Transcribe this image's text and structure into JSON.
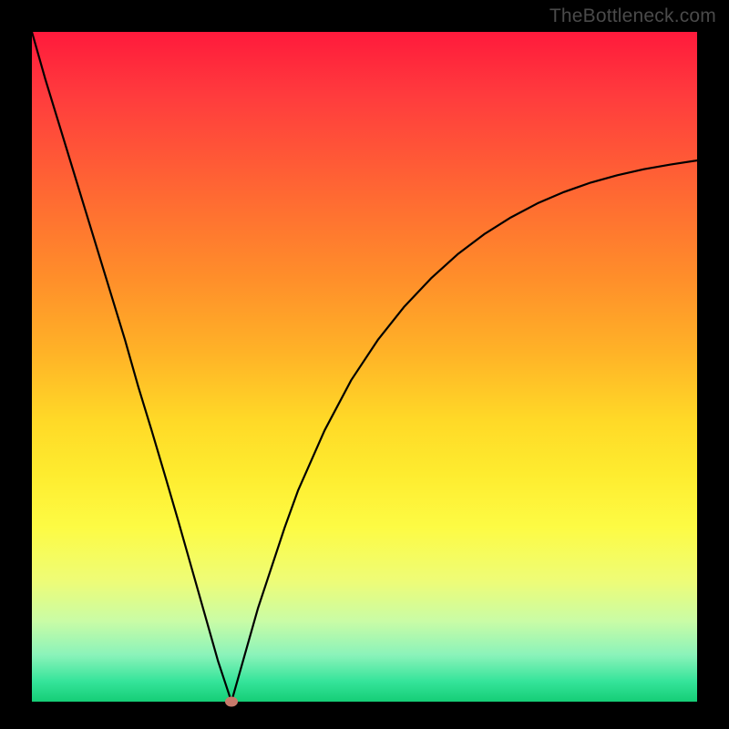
{
  "watermark": "TheBottleneck.com",
  "chart_data": {
    "type": "line",
    "title": "",
    "xlabel": "",
    "ylabel": "",
    "xlim": [
      0,
      100
    ],
    "ylim": [
      0,
      100
    ],
    "grid": false,
    "legend": false,
    "marker": {
      "x": 30,
      "y": 0,
      "color": "#c77a6b"
    },
    "gradient_stops": [
      {
        "pos": 0,
        "color": "#ff1a3c"
      },
      {
        "pos": 25,
        "color": "#ff6b32"
      },
      {
        "pos": 48,
        "color": "#ffb327"
      },
      {
        "pos": 66,
        "color": "#feec2f"
      },
      {
        "pos": 82,
        "color": "#eefc77"
      },
      {
        "pos": 97,
        "color": "#35e49a"
      },
      {
        "pos": 100,
        "color": "#15ce76"
      }
    ],
    "series": [
      {
        "name": "bottleneck-curve",
        "color": "#000000",
        "x": [
          0,
          2,
          4,
          6,
          8,
          10,
          12,
          14,
          16,
          18,
          20,
          22,
          24,
          26,
          27,
          28,
          29,
          30,
          31,
          32,
          33,
          34,
          36,
          38,
          40,
          44,
          48,
          52,
          56,
          60,
          64,
          68,
          72,
          76,
          80,
          84,
          88,
          92,
          96,
          100
        ],
        "y": [
          100,
          93,
          86.5,
          80,
          73.5,
          67,
          60.5,
          54,
          47,
          40.5,
          33.8,
          27,
          20,
          13,
          9.5,
          6,
          3,
          0,
          3.5,
          7,
          10.5,
          14,
          20,
          26,
          31.5,
          40.5,
          48,
          54,
          59,
          63.2,
          66.8,
          69.8,
          72.3,
          74.4,
          76.1,
          77.5,
          78.6,
          79.5,
          80.2,
          80.8
        ]
      }
    ]
  }
}
